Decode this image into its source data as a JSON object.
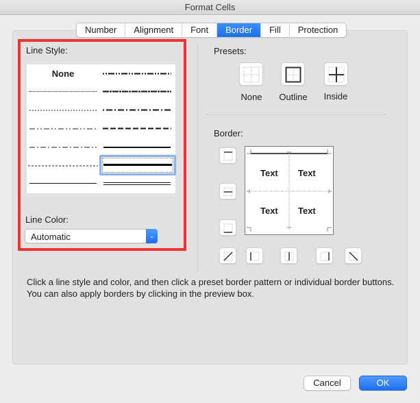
{
  "window": {
    "title": "Format Cells"
  },
  "tabs": [
    {
      "label": "Number",
      "active": false
    },
    {
      "label": "Alignment",
      "active": false
    },
    {
      "label": "Font",
      "active": false
    },
    {
      "label": "Border",
      "active": true
    },
    {
      "label": "Fill",
      "active": false
    },
    {
      "label": "Protection",
      "active": false
    }
  ],
  "line_style": {
    "label": "Line Style:",
    "none_label": "None",
    "styles": [
      {
        "id": "none",
        "column": "left",
        "row": 0
      },
      {
        "id": "hairline-dotted",
        "column": "left",
        "row": 1
      },
      {
        "id": "dotted",
        "column": "left",
        "row": 2
      },
      {
        "id": "dash-dot-dot-thin",
        "column": "left",
        "row": 3
      },
      {
        "id": "dash-dot-thin",
        "column": "left",
        "row": 4
      },
      {
        "id": "dashed-thin",
        "column": "left",
        "row": 5
      },
      {
        "id": "thin-solid",
        "column": "left",
        "row": 6
      },
      {
        "id": "dash-dot-dot-medium",
        "column": "right",
        "row": 0
      },
      {
        "id": "slanted-dash-dot",
        "column": "right",
        "row": 1
      },
      {
        "id": "dash-dot-medium",
        "column": "right",
        "row": 2
      },
      {
        "id": "dashed-medium",
        "column": "right",
        "row": 3
      },
      {
        "id": "medium-solid",
        "column": "right",
        "row": 4
      },
      {
        "id": "thick-solid",
        "column": "right",
        "row": 5,
        "selected": true
      },
      {
        "id": "double",
        "column": "right",
        "row": 6
      }
    ],
    "selected": "thick-solid"
  },
  "line_color": {
    "label": "Line Color:",
    "value": "Automatic"
  },
  "presets": {
    "label": "Presets:",
    "items": [
      {
        "id": "none",
        "label": "None"
      },
      {
        "id": "outline",
        "label": "Outline"
      },
      {
        "id": "inside",
        "label": "Inside"
      }
    ]
  },
  "border": {
    "label": "Border:",
    "preview_texts": [
      "Text",
      "Text",
      "Text",
      "Text"
    ],
    "applied_edges": [
      "top"
    ],
    "buttons": [
      "top",
      "inside-horizontal",
      "bottom",
      "diagonal-up",
      "left",
      "inside-vertical",
      "right",
      "diagonal-down"
    ]
  },
  "help_text": "Click a line style and color, and then click a preset border pattern or individual border buttons. You can also apply borders by clicking in the preview box.",
  "footer": {
    "cancel_label": "Cancel",
    "ok_label": "OK"
  },
  "colors": {
    "accent": "#1e6fef",
    "highlight_box": "#ee3431",
    "selection": "#8cb0f6"
  }
}
